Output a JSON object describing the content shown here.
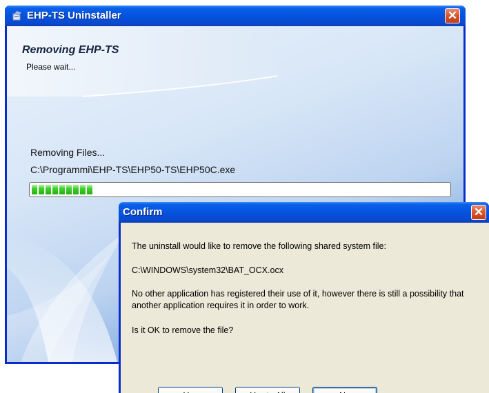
{
  "main_window": {
    "title": "EHP-TS Uninstaller",
    "close_glyph": "✕",
    "heading_title": "Removing EHP-TS",
    "heading_subtitle": "Please wait...",
    "status_text": "Removing Files...",
    "current_file": "C:\\Programmi\\EHP-TS\\EHP50-TS\\EHP50C.exe",
    "progress_fraction": 0.15
  },
  "confirm_dialog": {
    "title": "Confirm",
    "close_glyph": "✕",
    "message_line1": "The uninstall would like to remove the following shared system file:",
    "file_path": "C:\\WINDOWS\\system32\\BAT_OCX.ocx",
    "message_line3": "No other application has registered their use of it, however there is still a possibility that another application requires it in order to work.",
    "question": "Is it OK to remove the file?",
    "buttons": {
      "yes": "Yes",
      "yes_to_all": "Yes to All",
      "no": "No"
    }
  },
  "colors": {
    "titlebar_blue": "#0553de",
    "close_red": "#d9592f",
    "progress_green": "#3fce2a",
    "dialog_face": "#ece9d8"
  },
  "icons": {
    "app_icon": "uninstaller-icon",
    "close": "close-icon"
  }
}
